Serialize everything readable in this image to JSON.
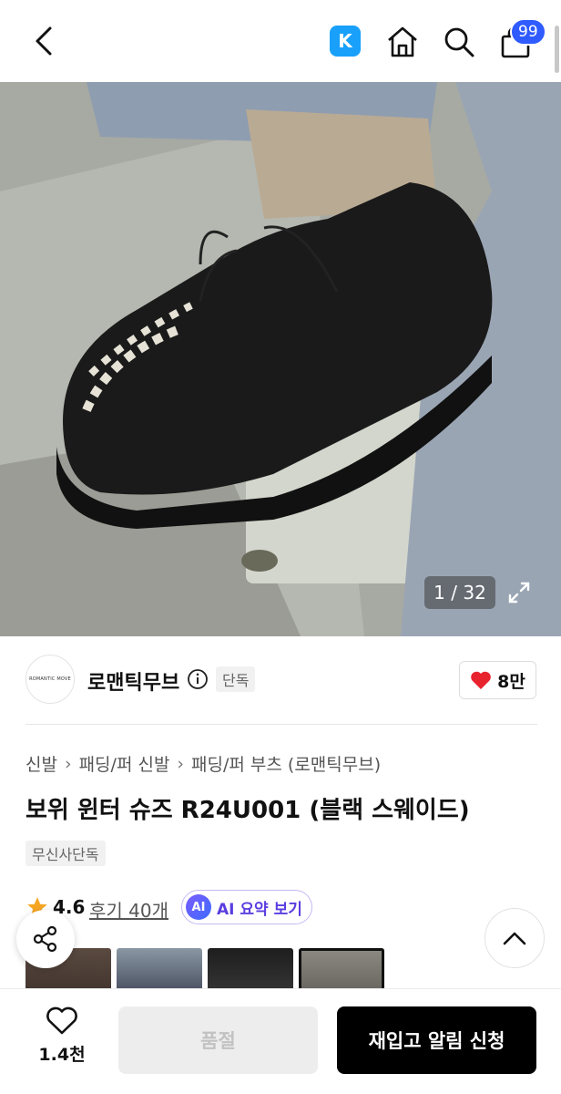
{
  "header": {
    "cart_count": "99",
    "k_badge": "K"
  },
  "gallery": {
    "counter": "1 / 32"
  },
  "brand": {
    "logo_text": "ROMANTIC MOVE",
    "name": "로맨틱무브",
    "badge": "단독",
    "likes": "8만"
  },
  "breadcrumb": [
    "신발",
    "패딩/퍼 신발",
    "패딩/퍼 부츠 (로맨틱무브)"
  ],
  "product": {
    "title": "보위 윈터 슈즈 R24U001 (블랙 스웨이드)",
    "tag": "무신사단독",
    "rating": "4.6",
    "reviews": "후기 40개",
    "ai_badge": "AI",
    "ai_label": "AI 요약 보기"
  },
  "bottom": {
    "wish_count": "1.4천",
    "soldout_label": "품절",
    "restock_label": "재입고 알림 신청"
  },
  "colors": {
    "accent_blue": "#2f5bff",
    "k_blue": "#18a0fb",
    "heart_red": "#e8232e",
    "star_orange": "#f5a623"
  }
}
